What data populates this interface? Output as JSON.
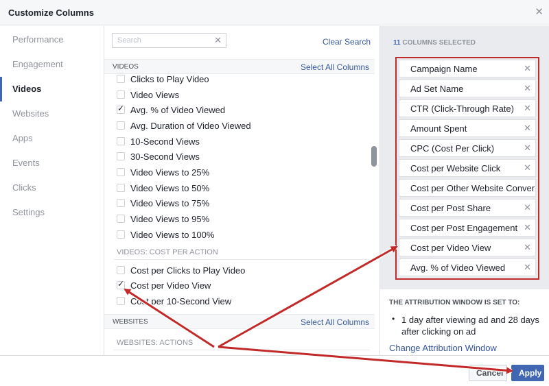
{
  "dialog": {
    "title": "Customize Columns",
    "close_glyph": "✕"
  },
  "nav": {
    "items": [
      {
        "label": "Performance"
      },
      {
        "label": "Engagement"
      },
      {
        "label": "Videos",
        "active": true
      },
      {
        "label": "Websites"
      },
      {
        "label": "Apps"
      },
      {
        "label": "Events"
      },
      {
        "label": "Clicks"
      },
      {
        "label": "Settings"
      }
    ]
  },
  "search": {
    "placeholder": "Search",
    "value": "",
    "clear_glyph": "✕",
    "clear_label": "Clear Search"
  },
  "videos": {
    "heading": "Videos",
    "select_all": "Select All Columns",
    "items": [
      {
        "label": "Clicks to Play Video",
        "checked": false
      },
      {
        "label": "Video Views",
        "checked": false
      },
      {
        "label": "Avg. % of Video Viewed",
        "checked": true
      },
      {
        "label": "Avg. Duration of Video Viewed",
        "checked": false
      },
      {
        "label": "10-Second Views",
        "checked": false
      },
      {
        "label": "30-Second Views",
        "checked": false
      },
      {
        "label": "Video Views to 25%",
        "checked": false
      },
      {
        "label": "Video Views to 50%",
        "checked": false
      },
      {
        "label": "Video Views to 75%",
        "checked": false
      },
      {
        "label": "Video Views to 95%",
        "checked": false
      },
      {
        "label": "Video Views to 100%",
        "checked": false
      }
    ]
  },
  "videos_cost": {
    "heading": "Videos: Cost per Action",
    "items": [
      {
        "label": "Cost per Clicks to Play Video",
        "checked": false
      },
      {
        "label": "Cost per Video View",
        "checked": true
      },
      {
        "label": "Cost per 10-Second View",
        "checked": false
      }
    ]
  },
  "websites": {
    "heading": "Websites",
    "select_all": "Select All Columns",
    "sub_heading": "Websites: Actions"
  },
  "selected": {
    "count": "11",
    "count_label": "Columns Selected",
    "remove_glyph": "✕",
    "items": [
      "Campaign Name",
      "Ad Set Name",
      "CTR (Click-Through Rate)",
      "Amount Spent",
      "CPC (Cost Per Click)",
      "Cost per Website Click",
      "Cost per Other Website Conver",
      "Cost per Post Share",
      "Cost per Post Engagement",
      "Cost per Video View",
      "Avg. % of Video Viewed"
    ]
  },
  "attribution": {
    "title": "The attribution window is set to:",
    "bullet": "•",
    "text": "1 day after viewing ad and 28 days after clicking on ad",
    "link": "Change Attribution Window"
  },
  "footer": {
    "cancel": "Cancel",
    "apply": "Apply"
  },
  "colors": {
    "accent": "#4267b2",
    "annotation": "#c22a2a"
  }
}
